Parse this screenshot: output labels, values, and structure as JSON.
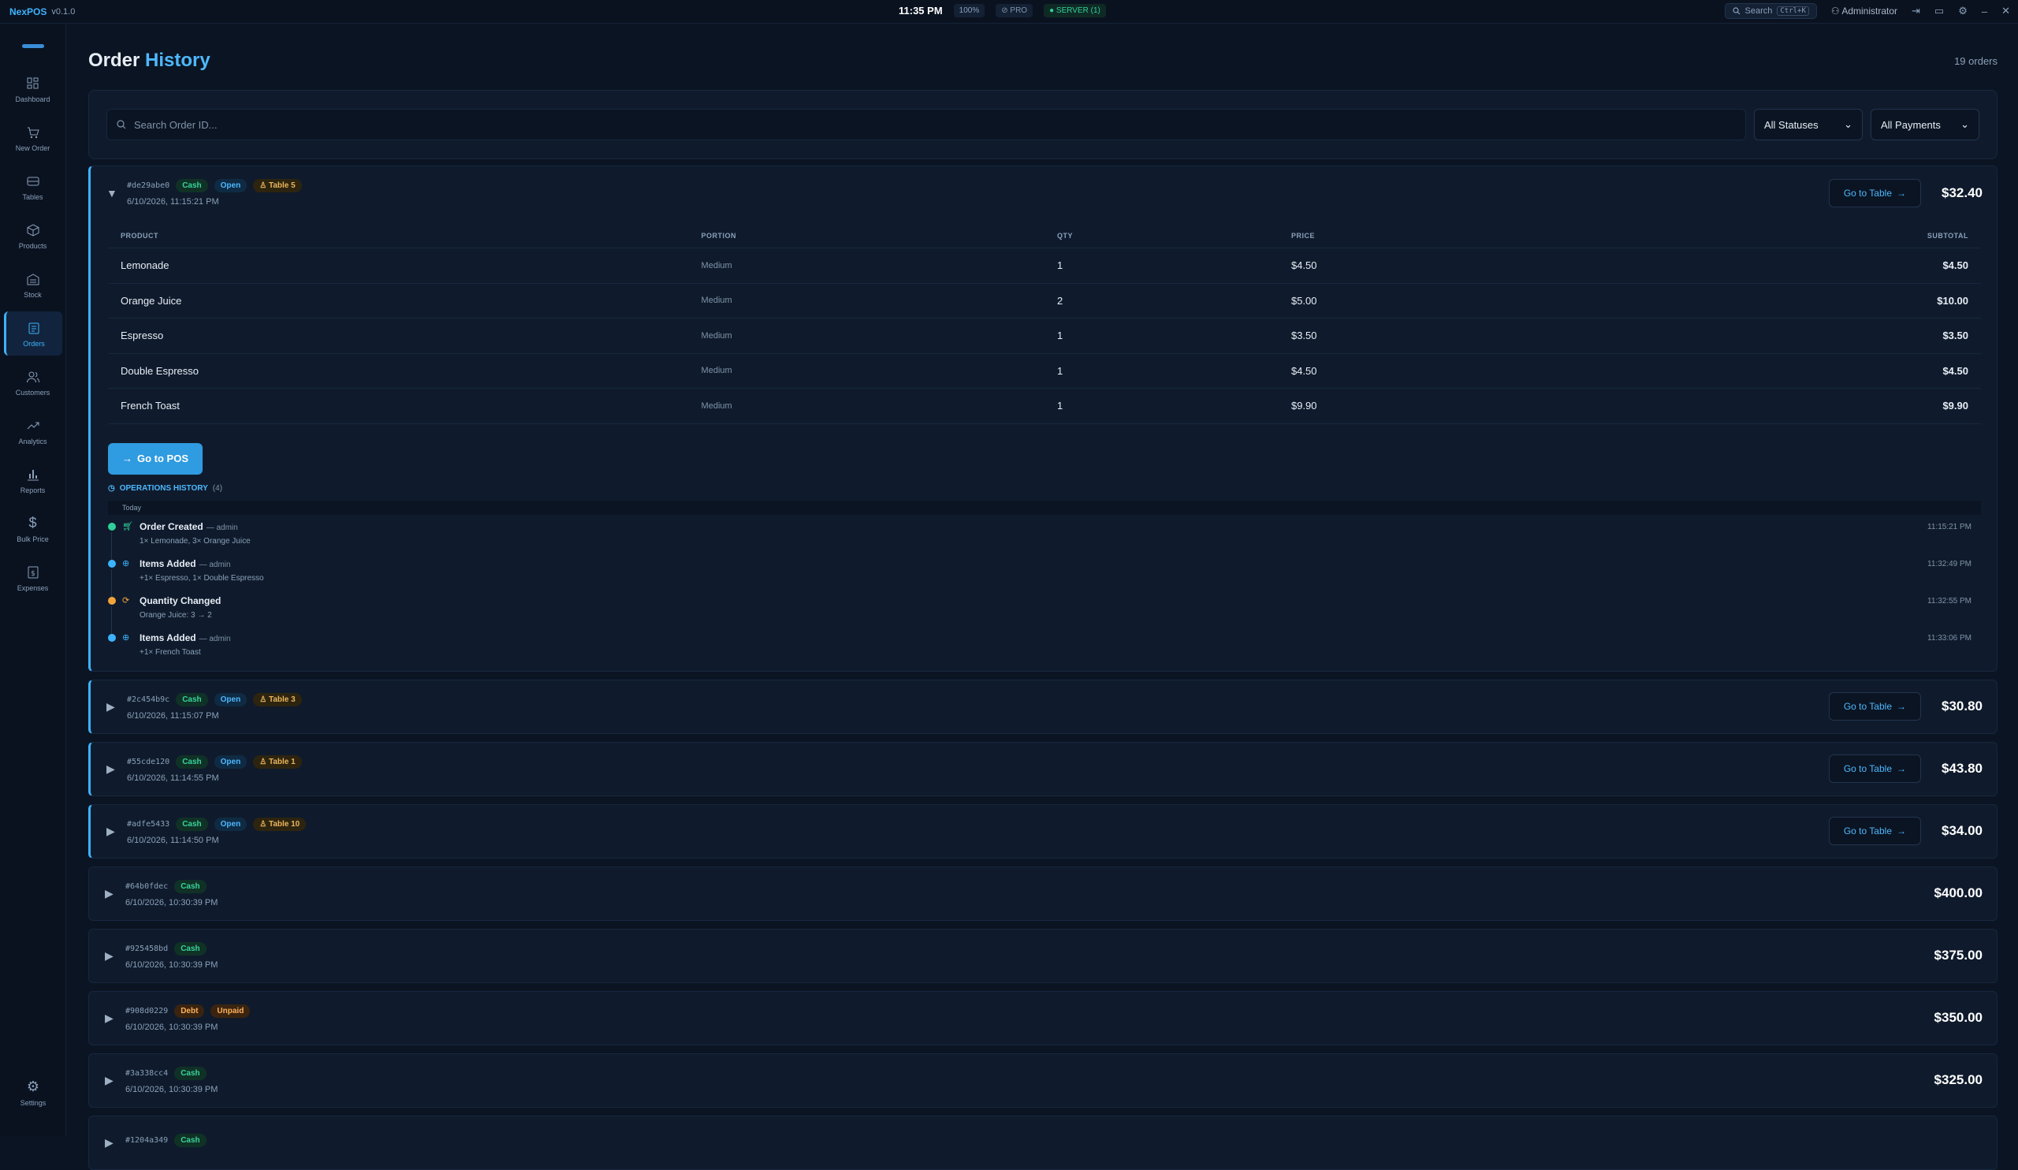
{
  "topbar": {
    "brand": "NexPOS",
    "version": "v0.1.0",
    "clock": "11:35 PM",
    "zoom": "100%",
    "pro": "PRO",
    "server": "SERVER (1)",
    "search_label": "Search",
    "search_kbd": "Ctrl+K",
    "user": "Administrator"
  },
  "sidebar": {
    "items": [
      {
        "label": "Dashboard"
      },
      {
        "label": "New Order"
      },
      {
        "label": "Tables"
      },
      {
        "label": "Products"
      },
      {
        "label": "Stock"
      },
      {
        "label": "Orders"
      },
      {
        "label": "Customers"
      },
      {
        "label": "Analytics"
      },
      {
        "label": "Reports"
      },
      {
        "label": "Bulk Price"
      },
      {
        "label": "Expenses"
      }
    ],
    "settings": "Settings"
  },
  "page": {
    "title_a": "Order",
    "title_b": "History",
    "count": "19 orders"
  },
  "filters": {
    "search_placeholder": "Search Order ID...",
    "status": "All Statuses",
    "payment": "All Payments"
  },
  "expanded": {
    "id": "#de29abe0",
    "payment": "Cash",
    "status": "Open",
    "table": "Table 5",
    "date": "6/10/2026, 11:15:21 PM",
    "go_table": "Go to Table",
    "total": "$32.40",
    "headers": {
      "product": "PRODUCT",
      "portion": "PORTION",
      "qty": "QTY",
      "price": "PRICE",
      "subtotal": "SUBTOTAL"
    },
    "items": [
      {
        "product": "Lemonade",
        "portion": "Medium",
        "qty": "1",
        "price": "$4.50",
        "subtotal": "$4.50"
      },
      {
        "product": "Orange Juice",
        "portion": "Medium",
        "qty": "2",
        "price": "$5.00",
        "subtotal": "$10.00"
      },
      {
        "product": "Espresso",
        "portion": "Medium",
        "qty": "1",
        "price": "$3.50",
        "subtotal": "$3.50"
      },
      {
        "product": "Double Espresso",
        "portion": "Medium",
        "qty": "1",
        "price": "$4.50",
        "subtotal": "$4.50"
      },
      {
        "product": "French Toast",
        "portion": "Medium",
        "qty": "1",
        "price": "$9.90",
        "subtotal": "$9.90"
      }
    ],
    "go_pos": "Go to POS",
    "ops_label": "OPERATIONS HISTORY",
    "ops_count": "(4)",
    "ops_day": "Today",
    "ops": [
      {
        "title": "Order Created",
        "by": "— admin",
        "desc": "1× Lemonade, 3× Orange Juice",
        "time": "11:15:21 PM",
        "color": "#2fd09a"
      },
      {
        "title": "Items Added",
        "by": "— admin",
        "desc": "+1× Espresso, 1× Double Espresso",
        "time": "11:32:49 PM",
        "color": "#3db3ff"
      },
      {
        "title": "Quantity Changed",
        "by": "",
        "desc": "Orange Juice: 3 → 2",
        "time": "11:32:55 PM",
        "color": "#f2a33a"
      },
      {
        "title": "Items Added",
        "by": "— admin",
        "desc": "+1× French Toast",
        "time": "11:33:06 PM",
        "color": "#3db3ff"
      }
    ]
  },
  "orders": [
    {
      "id": "#2c454b9c",
      "payment": "Cash",
      "status": "Open",
      "table": "Table 3",
      "date": "6/10/2026, 11:15:07 PM",
      "go_table": "Go to Table",
      "total": "$30.80"
    },
    {
      "id": "#55cde120",
      "payment": "Cash",
      "status": "Open",
      "table": "Table 1",
      "date": "6/10/2026, 11:14:55 PM",
      "go_table": "Go to Table",
      "total": "$43.80"
    },
    {
      "id": "#adfe5433",
      "payment": "Cash",
      "status": "Open",
      "table": "Table 10",
      "date": "6/10/2026, 11:14:50 PM",
      "go_table": "Go to Table",
      "total": "$34.00"
    },
    {
      "id": "#64b0fdec",
      "payment": "Cash",
      "date": "6/10/2026, 10:30:39 PM",
      "total": "$400.00"
    },
    {
      "id": "#925458bd",
      "payment": "Cash",
      "date": "6/10/2026, 10:30:39 PM",
      "total": "$375.00"
    },
    {
      "id": "#908d0229",
      "payment": "Debt",
      "status2": "Unpaid",
      "date": "6/10/2026, 10:30:39 PM",
      "total": "$350.00"
    },
    {
      "id": "#3a338cc4",
      "payment": "Cash",
      "date": "6/10/2026, 10:30:39 PM",
      "total": "$325.00"
    },
    {
      "id": "#1204a349",
      "payment": "Cash",
      "date": "",
      "total": ""
    }
  ]
}
